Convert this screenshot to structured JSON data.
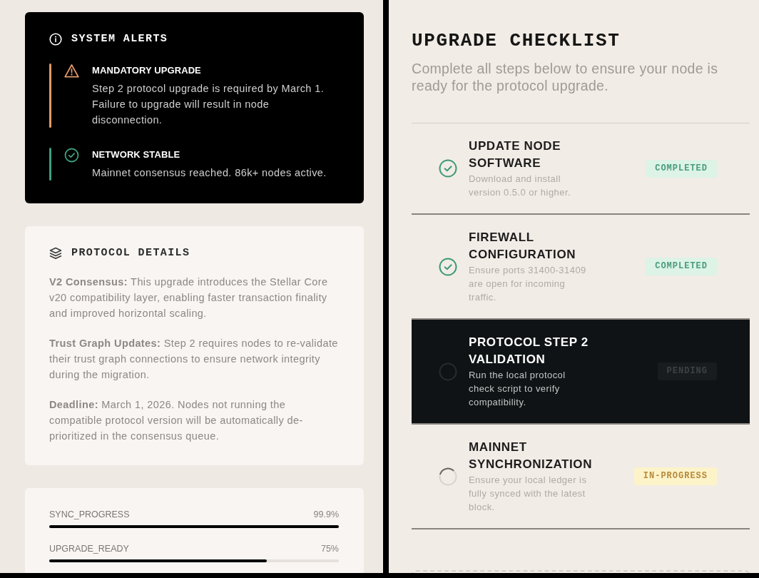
{
  "alerts_panel": {
    "title": "SYSTEM ALERTS",
    "alerts": [
      {
        "kind": "warning",
        "title": "MANDATORY UPGRADE",
        "message": "Step 2 protocol upgrade is required by March 1. Failure to upgrade will result in node disconnection."
      },
      {
        "kind": "success",
        "title": "NETWORK STABLE",
        "message": "Mainnet consensus reached. 86k+ nodes active."
      }
    ]
  },
  "protocol_details": {
    "title": "PROTOCOL DETAILS",
    "paragraphs": [
      "**V2 Consensus:** This upgrade introduces the Stellar Core v20 compatibility layer, enabling faster transaction finality and improved horizontal scaling.",
      "**Trust Graph Updates:** Step 2 requires nodes to re-validate their trust graph connections to ensure network integrity during the migration.",
      "**Deadline:** March 1, 2026. Nodes not running the compatible protocol version will be automatically de-prioritized in the consensus queue."
    ]
  },
  "metrics": [
    {
      "label": "SYNC_PROGRESS",
      "reading": "99.9%",
      "level": 0.999
    },
    {
      "label": "UPGRADE_READY",
      "reading": "75%",
      "level": 0.75
    }
  ],
  "checklist": {
    "title": "UPGRADE CHECKLIST",
    "subtitle": "Complete all steps below to ensure your node is ready for the protocol upgrade.",
    "steps": [
      {
        "kind": "completed",
        "title": "UPDATE NODE SOFTWARE",
        "description": "Download and install version 0.5.0 or higher.",
        "badge": "COMPLETED",
        "selected": false
      },
      {
        "kind": "completed",
        "title": "FIREWALL CONFIGURATION",
        "description": "Ensure ports 31400-31409 are open for incoming traffic.",
        "badge": "COMPLETED",
        "selected": false
      },
      {
        "kind": "pending",
        "title": "PROTOCOL STEP 2 VALIDATION",
        "description": "Run the local protocol check script to verify compatibility.",
        "badge": "PENDING",
        "selected": true
      },
      {
        "kind": "in_progress",
        "title": "MAINNET SYNCHRONIZATION",
        "description": "Ensure your local ledger is fully synced with the latest block.",
        "badge": "IN-PROGRESS",
        "selected": false
      }
    ]
  }
}
